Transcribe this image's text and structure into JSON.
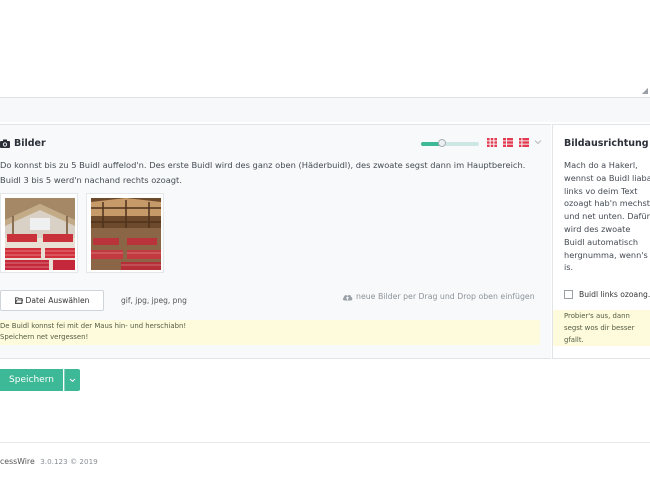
{
  "textarea": {
    "resize_glyph": "◢"
  },
  "images_field": {
    "label": "Bilder",
    "label_icon": "camera-icon",
    "size_slider": {
      "value": 0.33
    },
    "view_icons": [
      "grid-icon",
      "grid-list-icon",
      "list-icon"
    ],
    "view_icon_color": "#e23b52",
    "collapse_icon": "chevron-down-icon",
    "description": "Do konnst bis zu 5 Buidl auffelod'n. Des erste Buidl wird des ganz oben (Häderbuidl), des zwoate segst dann im Hauptbereich. Buidl 3 bis 5 werd'n nachand rechts ozoagt.",
    "thumbnails": [
      {
        "name": "hall-interior-1"
      },
      {
        "name": "hall-interior-2"
      }
    ],
    "file_button_label": "Datei Auswählen",
    "file_button_icon": "folder-open-icon",
    "allowed_extensions": "gif, jpg, jpeg, png",
    "dropzone_hint": "neue Bilder per Drag und Drop oben einfügen",
    "dropzone_icon": "cloud-upload-icon",
    "notes": [
      "De Buidl konnst fei mit der Maus hin- und herschiabn!",
      "Speichern net vergessen!"
    ]
  },
  "alignment_field": {
    "label": "Bildausrichtung",
    "description": [
      "Mach do a Hakerl,",
      "wennst oa Buidl liaba",
      "links vo deim Text",
      "ozoagt hab'n mechst",
      "und net unten. Dafür",
      "wird des zwoate",
      "Buidl automatisch",
      "hergnumma, wenn's",
      "is."
    ],
    "checkbox_label": "Buidl links ozoang.",
    "checkbox_checked": false,
    "notes": [
      "Probier's aus, dann",
      "segst wos dir besser",
      "gfallt."
    ]
  },
  "actions": {
    "save_label": "Speichern",
    "save_dropdown_icon": "chevron-down-icon",
    "accent_color": "#3eb998"
  },
  "footer": {
    "product": "cessWire",
    "version": "3.0.123 © 2019"
  }
}
